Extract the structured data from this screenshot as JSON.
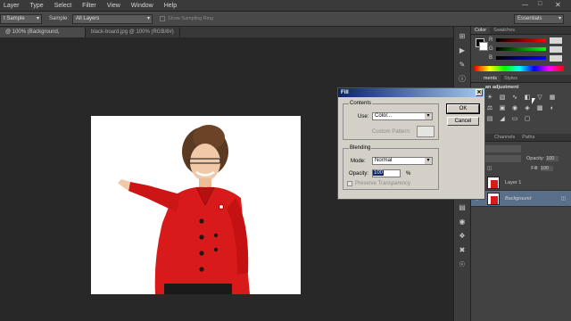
{
  "menu": [
    "Layer",
    "Type",
    "Select",
    "Filter",
    "View",
    "Window",
    "Help"
  ],
  "options": {
    "sample_size": "t Sample",
    "sample_label": "Sample:",
    "sample_value": "All Layers",
    "show_ring": "Show Sampling Ring",
    "workspace": "Essentials"
  },
  "doc_tabs": [
    {
      "label": "@ 100% (Background, RGB/8*) *",
      "close": "×"
    },
    {
      "label": "black-board.jpg @ 100% (RGB/8#) *",
      "close": "×"
    }
  ],
  "color_panel": {
    "tabs": [
      "Color",
      "Swatches"
    ],
    "rows": [
      {
        "label": "R",
        "value": ""
      },
      {
        "label": "G",
        "value": ""
      },
      {
        "label": "B",
        "value": ""
      }
    ]
  },
  "adjustments_panel": {
    "tabs": [
      "ments",
      "Styles"
    ],
    "title": "an adjustment"
  },
  "layers_panel": {
    "tabs": [
      "Channels",
      "Paths"
    ],
    "opacity_label": "Opacity:",
    "opacity_value": "100",
    "fill_label": "Fill:",
    "fill_value": "100",
    "layers": [
      {
        "name": "Layer 1",
        "selected": false
      },
      {
        "name": "Background",
        "selected": true
      }
    ]
  },
  "fill_dialog": {
    "title": "Fill",
    "close": "✕",
    "contents_legend": "Contents",
    "use_label": "Use:",
    "use_value": "Color...",
    "custom_pattern_label": "Custom Pattern:",
    "blending_legend": "Blending",
    "mode_label": "Mode:",
    "mode_value": "Normal",
    "opacity_label": "Opacity:",
    "opacity_value": "100",
    "opacity_unit": "%",
    "preserve_label": "Preserve Transparency",
    "ok_label": "OK",
    "cancel_label": "Cancel"
  },
  "colors": {
    "accent_selection": "#5a6f8a",
    "jacket_red": "#d91a1a",
    "dialog_face": "#d4d0c8"
  }
}
